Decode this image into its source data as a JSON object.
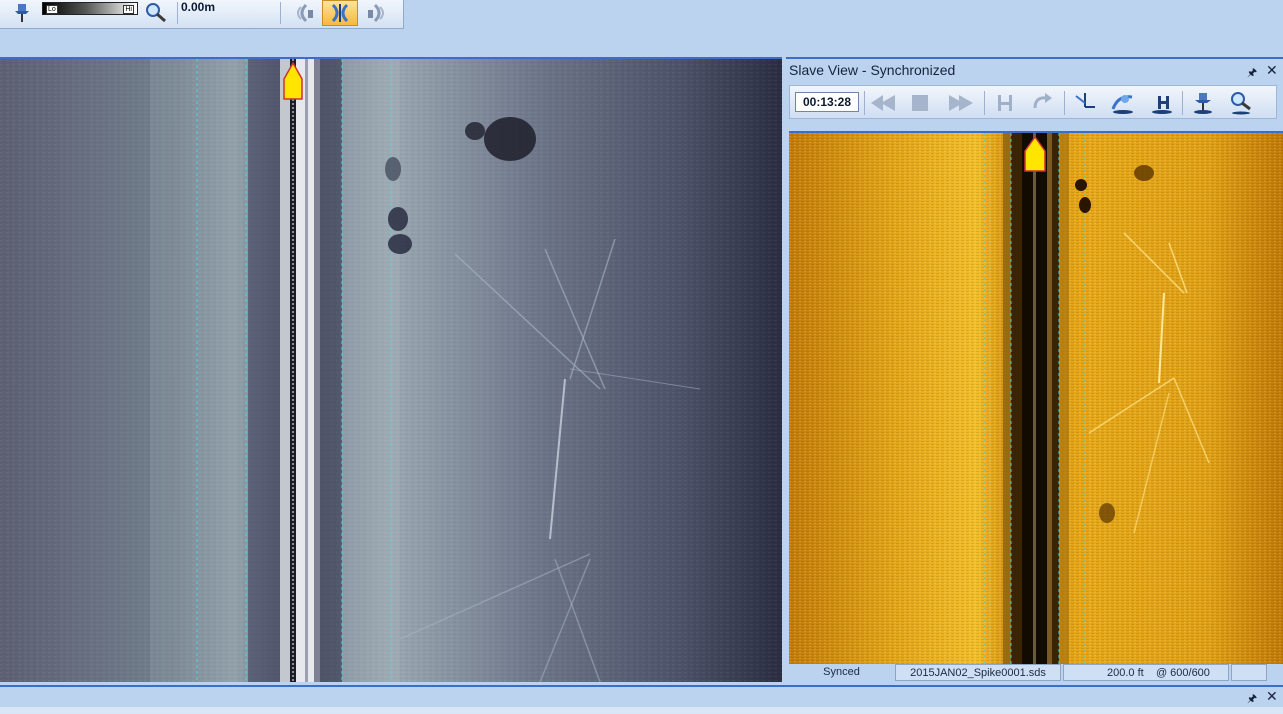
{
  "toolbar": {
    "gain_low_label": "Lo",
    "gain_high_label": "Hi",
    "depth_readout": "0.00m",
    "icons": [
      "pin-icon",
      "gain-slider",
      "zoom-icon",
      "sonar-left-icon",
      "sonar-both-icon",
      "sonar-right-icon"
    ]
  },
  "slave_view": {
    "title": "Slave View - Synchronized",
    "time": "00:13:28",
    "toolbar_icons": [
      "rewind-icon",
      "stop-icon",
      "fast-forward-icon",
      "height-icon",
      "redo-icon",
      "layback-icon",
      "target-icon",
      "measure-icon",
      "pin-icon",
      "zoom-icon"
    ]
  },
  "status_bar": {
    "sync_state": "Synced",
    "file_name": "2015JAN02_Spike0001.sds",
    "range": "200.0 ft",
    "ping": "@ 600/600"
  },
  "colors": {
    "main_sonar_palette": "#5c6479",
    "slave_sonar_palette": "#d99a10",
    "accent_border": "#3b6fc7",
    "boat_marker": "#ffe500"
  }
}
